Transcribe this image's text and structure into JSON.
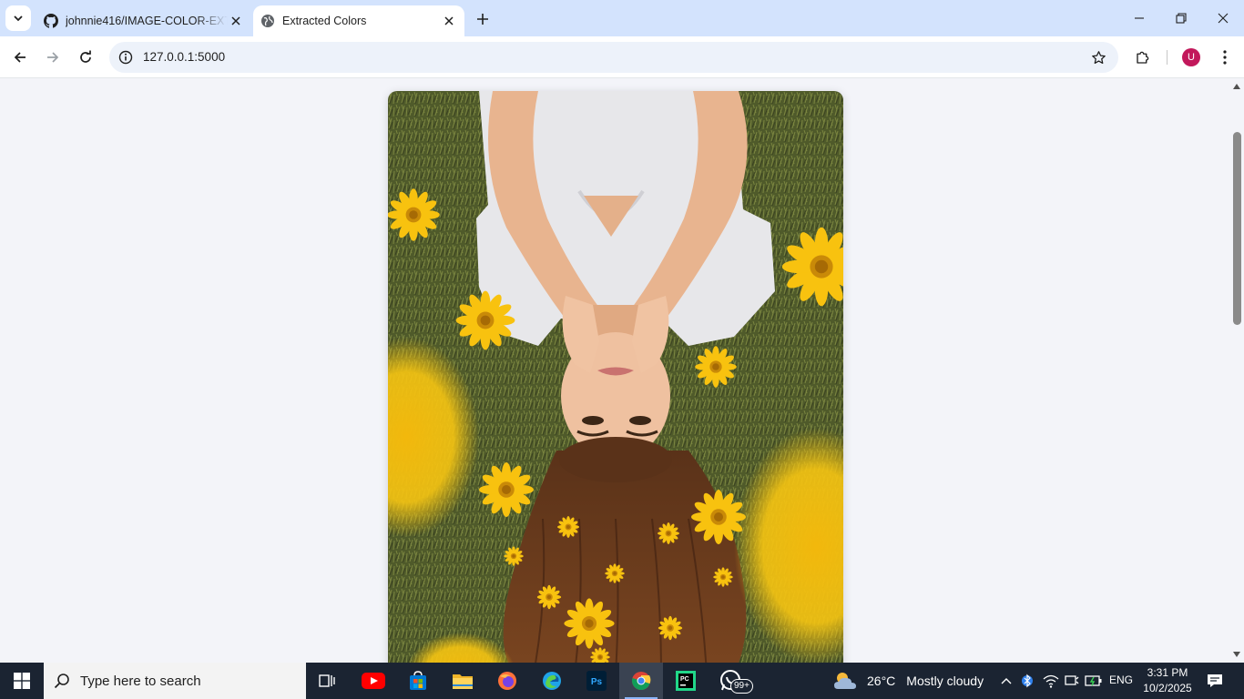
{
  "browser": {
    "tabs": [
      {
        "title": "johnnie416/IMAGE-COLOR-EXT",
        "favicon": "github-icon",
        "active": false
      },
      {
        "title": "Extracted Colors",
        "favicon": "globe-icon",
        "active": true
      }
    ],
    "address": "127.0.0.1:5000",
    "profile_initial": "U",
    "colors": {
      "titlebar": "#d3e3fd",
      "toolbar": "#ffffff",
      "omnibox": "#edf2fa",
      "avatar": "#c2185b"
    }
  },
  "page": {
    "background": "#f3f4f9",
    "image": {
      "description_icon": "photo",
      "dominant_colors": [
        "#4f5a2a",
        "#f6c512",
        "#6b3a1e",
        "#eeeef0",
        "#e7b38f"
      ]
    }
  },
  "taskbar": {
    "search_placeholder": "Type here to search",
    "apps": [
      "task-view",
      "youtube",
      "microsoft-store",
      "file-explorer",
      "firefox",
      "edge",
      "photoshop",
      "chrome",
      "pycharm",
      "whatsapp"
    ],
    "whatsapp_badge": "99+",
    "weather": {
      "temp": "26°C",
      "condition": "Mostly cloudy"
    },
    "language": "ENG",
    "time": "3:31 PM",
    "date": "10/2/2025"
  }
}
